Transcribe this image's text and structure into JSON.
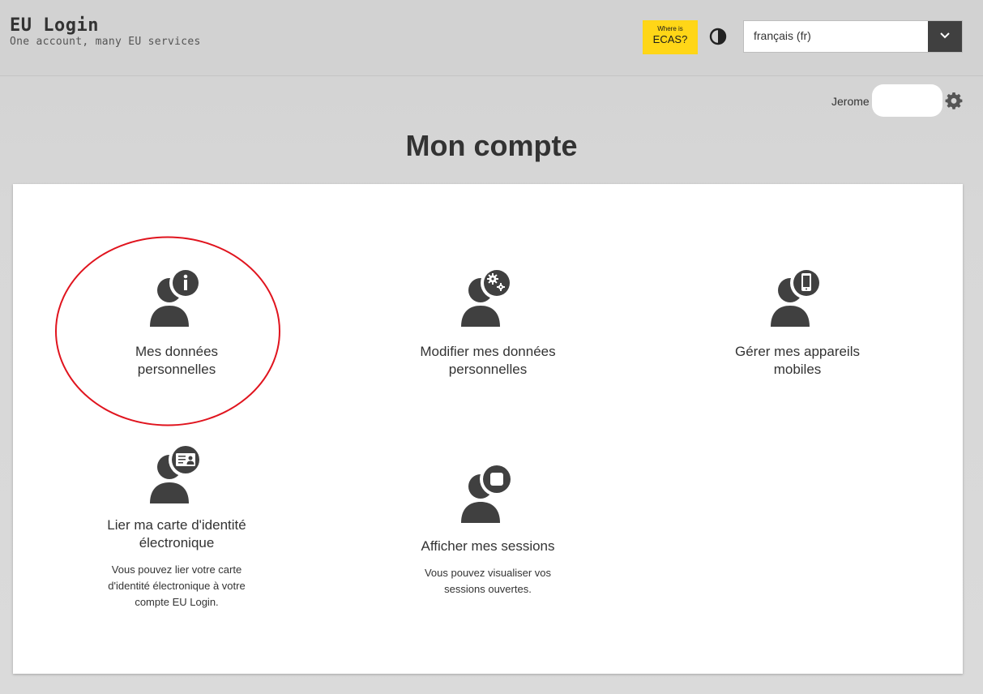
{
  "header": {
    "title": "EU Login",
    "subtitle": "One account, many EU services",
    "ecas_small": "Where is",
    "ecas_big": "ECAS?",
    "language_selected": "français (fr)"
  },
  "user": {
    "name": "Jerome"
  },
  "page": {
    "title": "Mon compte"
  },
  "tiles": [
    {
      "icon": "user-info-icon",
      "title_line1": "Mes données",
      "title_line2": "personnelles",
      "description": []
    },
    {
      "icon": "user-settings-icon",
      "title_line1": "Modifier mes données",
      "title_line2": "personnelles",
      "description": []
    },
    {
      "icon": "user-mobile-icon",
      "title_line1": "Gérer mes appareils",
      "title_line2": "mobiles",
      "description": []
    },
    {
      "icon": "user-id-card-icon",
      "title_line1": "Lier ma carte d'identité",
      "title_line2": "électronique",
      "description": [
        "Vous pouvez lier votre carte",
        "d'identité électronique à votre",
        "compte EU Login."
      ]
    },
    {
      "icon": "user-sessions-icon",
      "title_line1": "Afficher mes sessions",
      "title_line2": "",
      "description": [
        "Vous pouvez visualiser vos",
        "sessions ouvertes."
      ]
    }
  ],
  "colors": {
    "accent_yellow": "#ffd617",
    "highlight_red": "#e0141e",
    "icon_dark": "#404040"
  }
}
